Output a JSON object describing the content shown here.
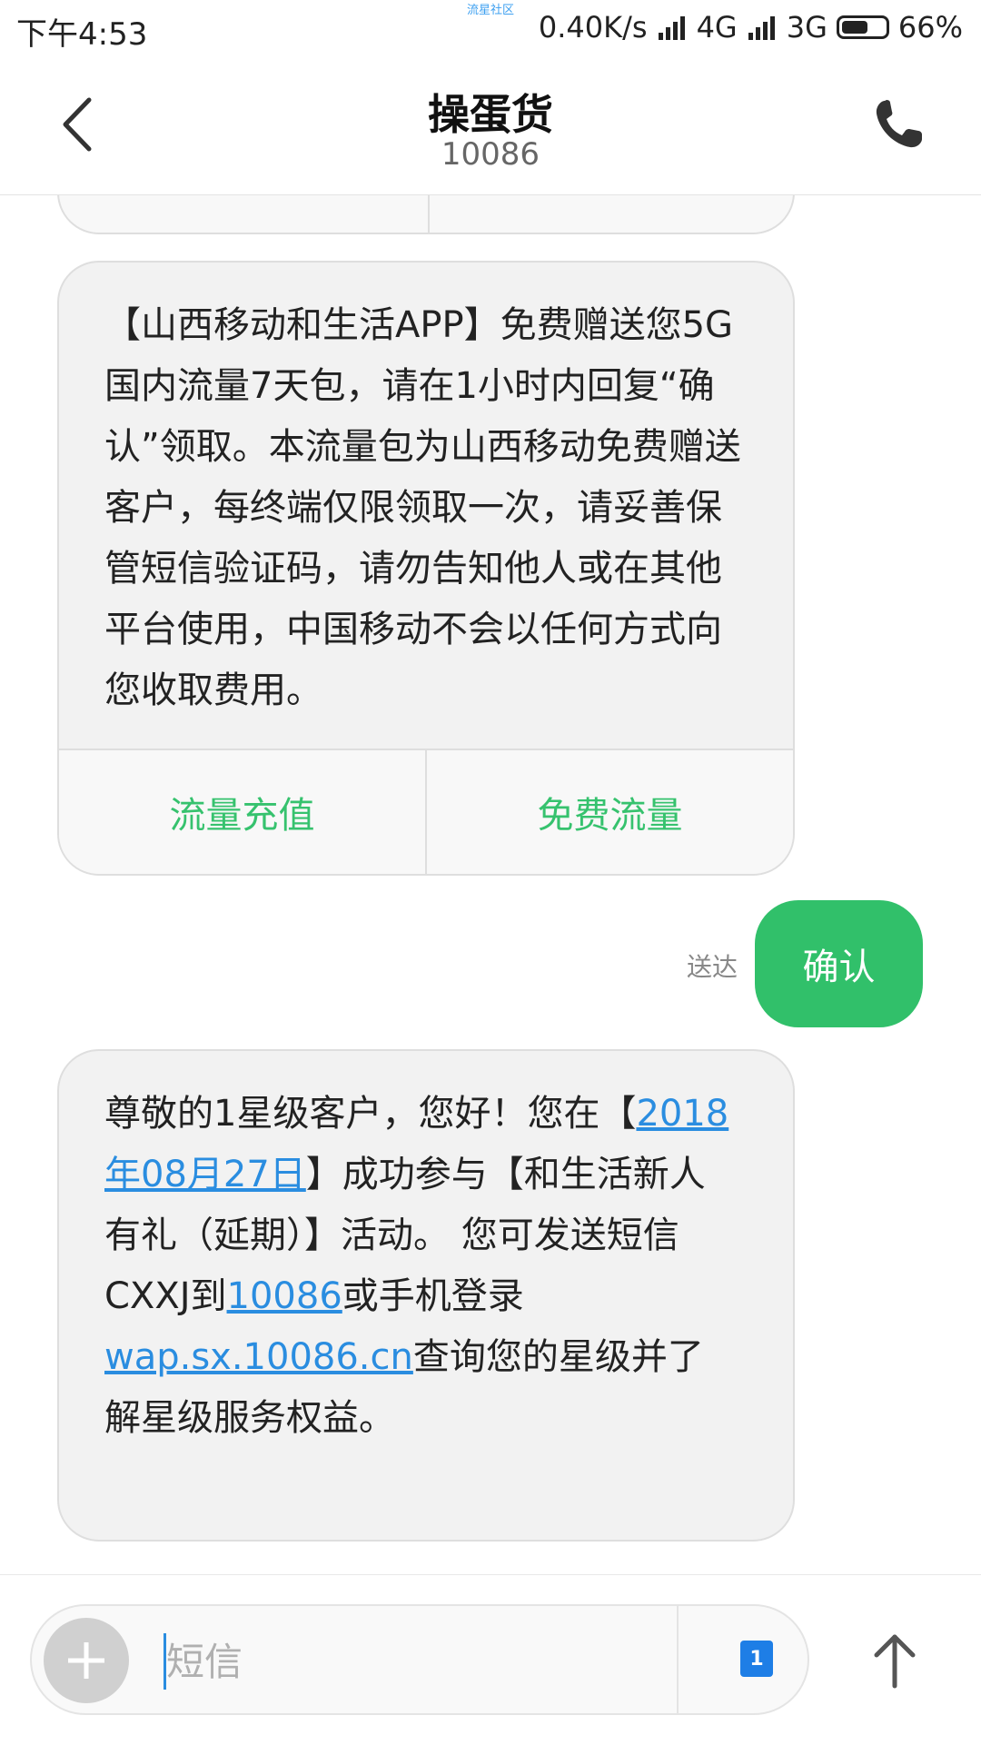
{
  "status_bar": {
    "time": "下午4:53",
    "watermark": "流星社区",
    "net_speed": "0.40K/s",
    "network1": "4G",
    "network2": "3G",
    "battery": "66%",
    "battery_level": 0.66
  },
  "header": {
    "title": "操蛋货",
    "number": "10086"
  },
  "messages": {
    "msg1": {
      "text": "【山西移动和生活APP】免费赠送您5G国内流量7天包，请在1小时内回复“确认”领取。本流量包为山西移动免费赠送客户，每终端仅限领取一次，请妥善保管短信验证码，请勿告知他人或在其他平台使用，中国移动不会以任何方式向您收取费用。",
      "action1": "流量充值",
      "action2": "免费流量"
    },
    "reply": {
      "status": "送达",
      "text": "确认"
    },
    "msg2": {
      "part1": "尊敬的1星级客户，您好！您在【",
      "link_date": "2018年08月27日",
      "part2": "】成功参与【和生活新人有礼（延期）】活动。 您可发送短信CXXJ到",
      "link_number": "10086",
      "part3": "或手机登录",
      "link_url": "wap.sx.10086.cn",
      "part4": "查询您的星级并了解星级服务权益。"
    }
  },
  "composer": {
    "placeholder": "短信",
    "sim": "1"
  },
  "colors": {
    "accent_green": "#31c06a",
    "link_blue": "#2a8de0"
  },
  "icons": {
    "back": "chevron-left-icon",
    "call": "phone-icon",
    "add": "plus-icon",
    "sim": "sim-card-icon",
    "send": "arrow-up-icon"
  }
}
